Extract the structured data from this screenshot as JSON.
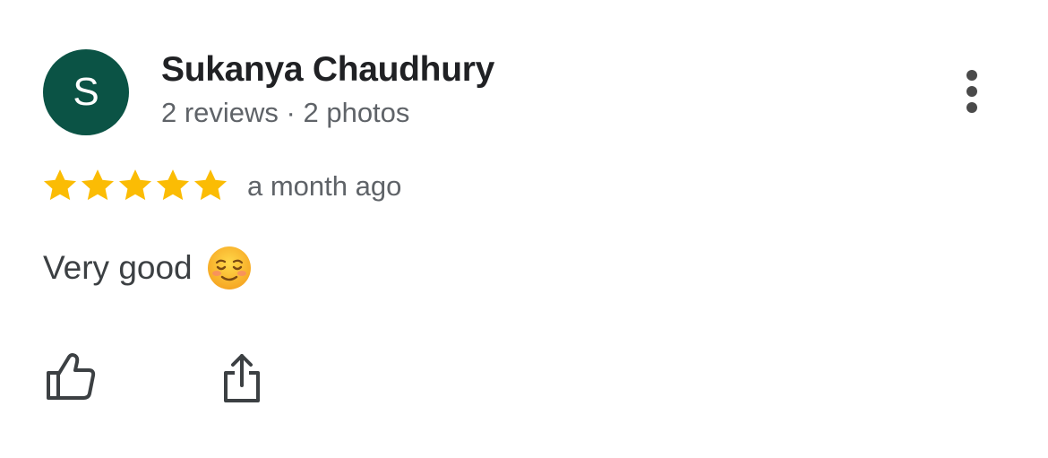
{
  "reviewer": {
    "initial": "S",
    "name": "Sukanya Chaudhury",
    "meta": "2 reviews · 2 photos",
    "avatar_color": "#0b5345"
  },
  "review": {
    "rating": 5,
    "rating_max": 5,
    "star_color": "#fbbc04",
    "time": "a month ago",
    "text": "Very good",
    "emoji_icon": "smiling-face-emoji"
  },
  "actions": {
    "like_icon": "thumbs-up-icon",
    "share_icon": "share-icon",
    "more_icon": "more-vert-icon"
  }
}
